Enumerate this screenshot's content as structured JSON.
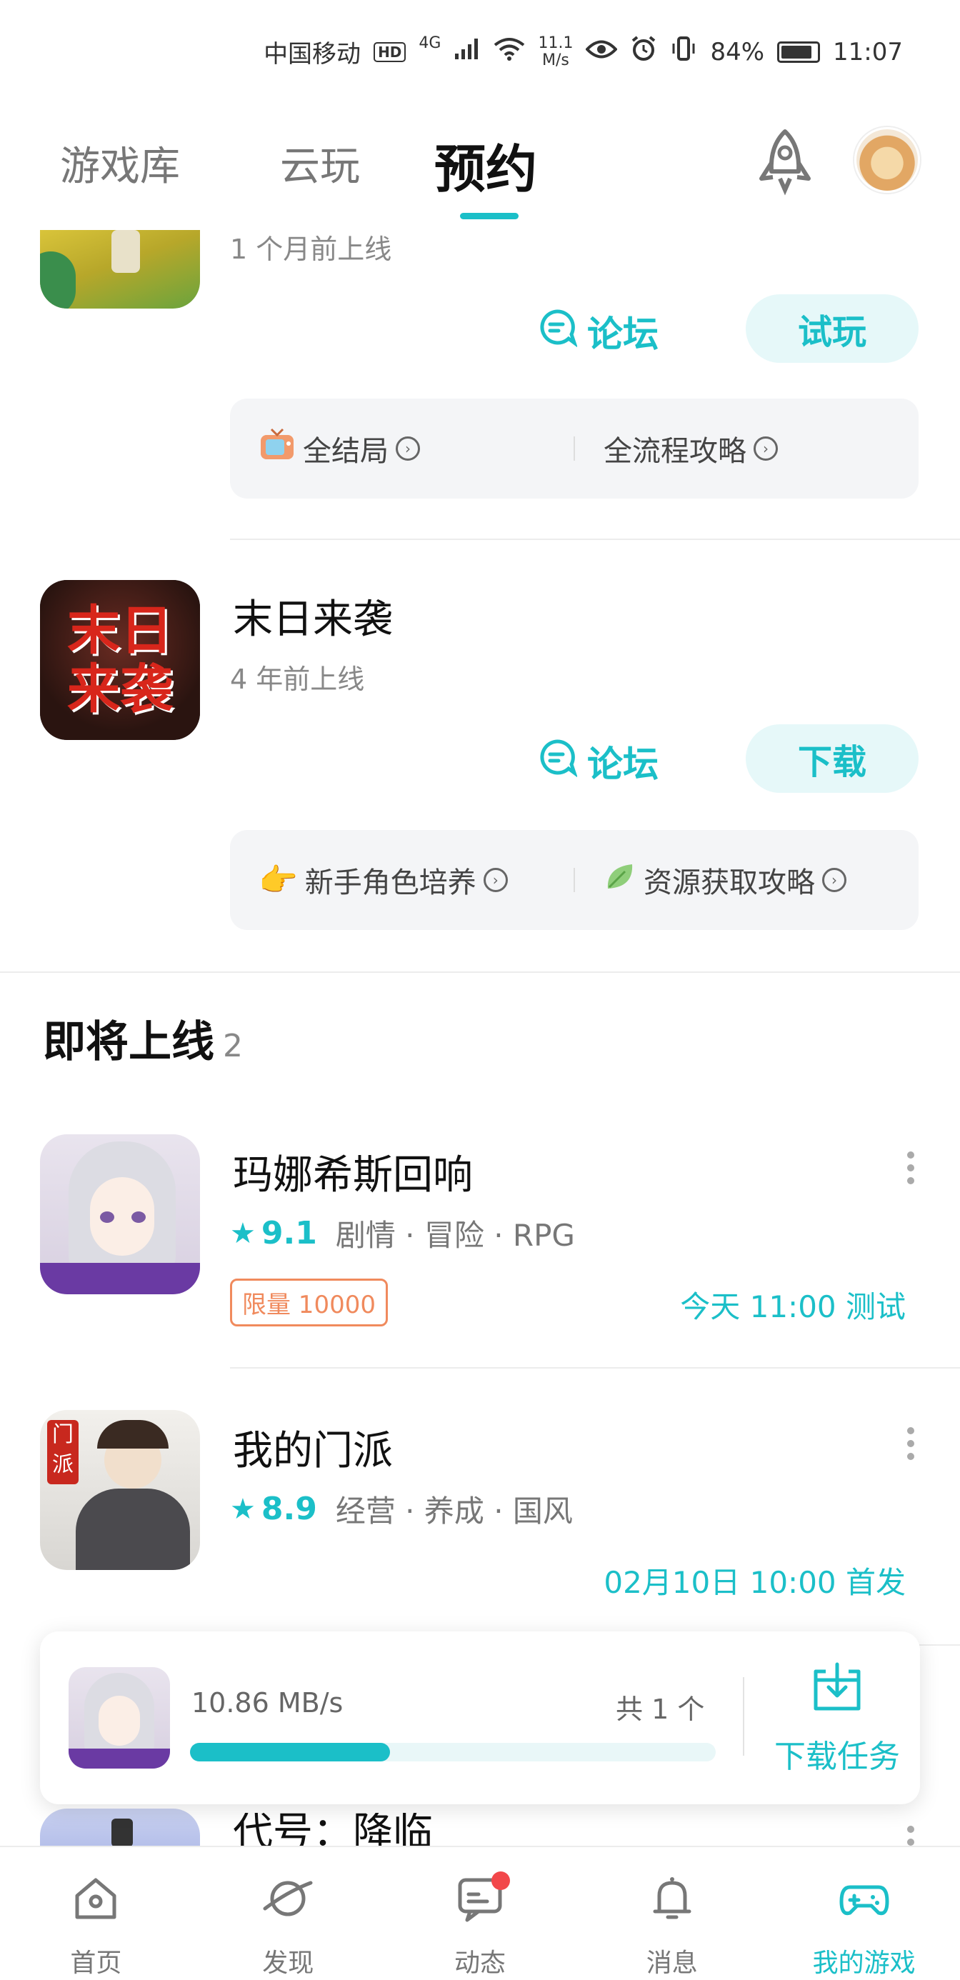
{
  "status_bar": {
    "carrier": "中国移动",
    "hd": "HD",
    "network": "4G",
    "speed_value": "11.1",
    "speed_unit": "M/s",
    "battery": "84%",
    "time": "11:07"
  },
  "top_tabs": [
    {
      "label": "游戏库"
    },
    {
      "label": "云玩"
    },
    {
      "label": "预约"
    }
  ],
  "active_tab": "预约",
  "released_games": [
    {
      "title": "",
      "released": "1 个月前上线",
      "forum_label": "论坛",
      "action_label": "试玩",
      "guides": [
        {
          "icon": "tv-icon",
          "label": "全结局"
        },
        {
          "icon": "",
          "label": "全流程攻略"
        }
      ]
    },
    {
      "title": "末日来袭",
      "released": "4 年前上线",
      "forum_label": "论坛",
      "action_label": "下载",
      "guides": [
        {
          "icon": "pointing-hand-icon",
          "label": "新手角色培养"
        },
        {
          "icon": "leaf-icon",
          "label": "资源获取攻略"
        }
      ]
    }
  ],
  "upcoming": {
    "title": "即将上线",
    "count": "2",
    "games": [
      {
        "title": "玛娜希斯回响",
        "score": "9.1",
        "tags": "剧情 · 冒险 · RPG",
        "badge": "限量 10000",
        "release": "今天 11:00 测试"
      },
      {
        "title": "我的门派",
        "score": "8.9",
        "tags": "经营 · 养成 · 国风",
        "badge": "",
        "release": "02月10日 10:00 首发"
      }
    ],
    "partial_next_title": "代号：降临"
  },
  "download_task": {
    "speed": "10.86 MB/s",
    "count": "共 1 个",
    "progress": 0.38,
    "task_label": "下载任务"
  },
  "bottom_nav": [
    {
      "label": "首页",
      "icon": "home-icon"
    },
    {
      "label": "发现",
      "icon": "planet-icon"
    },
    {
      "label": "动态",
      "icon": "chat-icon"
    },
    {
      "label": "消息",
      "icon": "bell-icon"
    },
    {
      "label": "我的游戏",
      "icon": "gamepad-icon"
    }
  ],
  "colors": {
    "accent": "#1bbfc8",
    "badge": "#f08a5d",
    "notification": "#f2474a"
  }
}
